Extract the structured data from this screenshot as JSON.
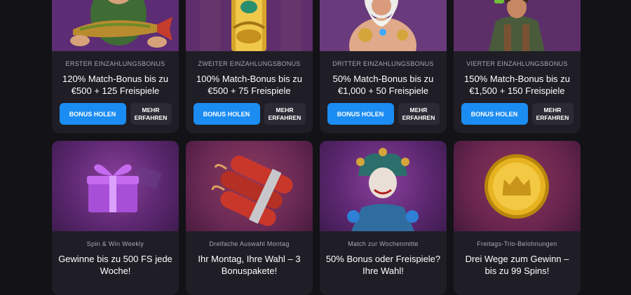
{
  "top_cards": [
    {
      "subtitle": "ERSTER EINZAHLUNGSBONUS",
      "title": "120% Match-Bonus bis zu €500 + 125 Freispiele",
      "primary": "BONUS HOLEN",
      "secondary": "MEHR ERFAHREN",
      "art_icon": "fisherman-fish-icon"
    },
    {
      "subtitle": "ZWEITER EINZAHLUNGSBONUS",
      "title": "100% Match-Bonus bis zu €500 + 75 Freispiele",
      "primary": "BONUS HOLEN",
      "secondary": "MEHR ERFAHREN",
      "art_icon": "golden-scarab-pillar-icon"
    },
    {
      "subtitle": "DRITTER EINZAHLUNGSBONUS",
      "title": "50% Match-Bonus bis zu €1,000 + 50 Freispiele",
      "primary": "BONUS HOLEN",
      "secondary": "MEHR ERFAHREN",
      "art_icon": "zeus-icon"
    },
    {
      "subtitle": "VIERTER EINZAHLUNGSBONUS",
      "title": "150% Match-Bonus bis zu €1,500 + 150 Freispiele",
      "primary": "BONUS HOLEN",
      "secondary": "MEHR ERFAHREN",
      "art_icon": "explorer-icon"
    }
  ],
  "bottom_cards": [
    {
      "subtitle": "Spin & Win Weekly",
      "title": "Gewinne bis zu 500 FS jede Woche!",
      "art_icon": "gift-box-icon"
    },
    {
      "subtitle": "Dreifache Auswahl Montag",
      "title": "Ihr Montag, Ihre Wahl – 3 Bonuspakete!",
      "art_icon": "dynamite-icon"
    },
    {
      "subtitle": "Match zur Wochenmitte",
      "title": "50% Bonus oder Freispiele? Ihre Wahl!",
      "art_icon": "jester-icon"
    },
    {
      "subtitle": "Freitags-Trio-Belohnungen",
      "title": "Drei Wege zum Gewinn – bis zu 99 Spins!",
      "art_icon": "gold-coin-icon"
    }
  ],
  "colors": {
    "background": "#131217",
    "card": "#1f1e26",
    "primary_button": "#1b8cf2",
    "secondary_button": "#2c2b35"
  }
}
